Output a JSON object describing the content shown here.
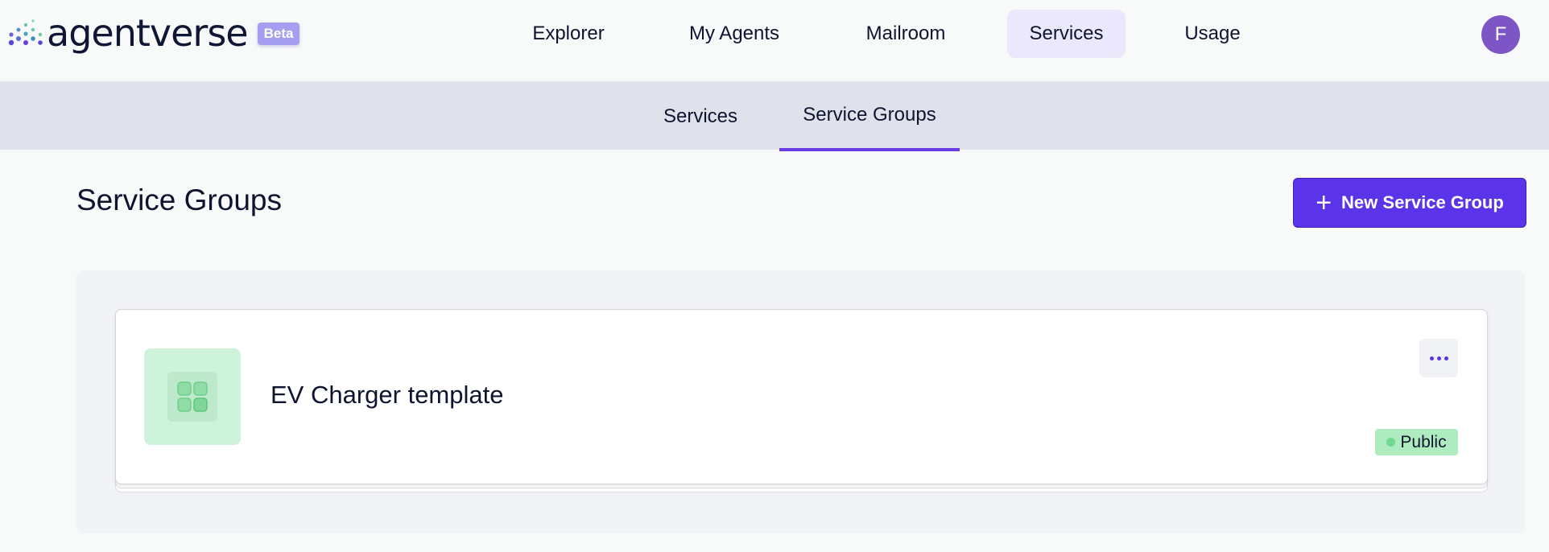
{
  "app": {
    "logo_text": "agentverse",
    "beta_label": "Beta"
  },
  "nav": {
    "items": [
      {
        "label": "Explorer"
      },
      {
        "label": "My Agents"
      },
      {
        "label": "Mailroom"
      },
      {
        "label": "Services",
        "active": true
      },
      {
        "label": "Usage"
      }
    ],
    "avatar_initial": "F"
  },
  "subnav": {
    "tabs": [
      {
        "label": "Services"
      },
      {
        "label": "Service Groups",
        "active": true
      }
    ]
  },
  "page": {
    "title": "Service Groups",
    "new_button_label": "New Service Group"
  },
  "service_groups": [
    {
      "name": "EV Charger template",
      "icon": "grid-icon",
      "status": "Public",
      "status_color": "#aeebbe"
    }
  ],
  "colors": {
    "accent": "#5b33e8",
    "avatar": "#7d55c4",
    "status_public": "#6fd98e"
  }
}
